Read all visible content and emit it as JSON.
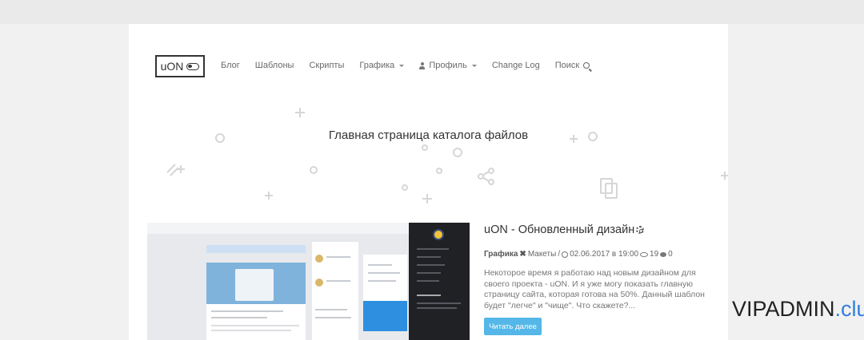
{
  "logo": {
    "text": "uON"
  },
  "nav": {
    "items": [
      {
        "label": "Блог"
      },
      {
        "label": "Шаблоны"
      },
      {
        "label": "Скрипты"
      },
      {
        "label": "Графика"
      },
      {
        "label": "Профиль"
      },
      {
        "label": "Change Log"
      },
      {
        "label": "Поиск"
      }
    ]
  },
  "hero": {
    "title": "Главная страница каталога файлов"
  },
  "post": {
    "title": "uON - Обновленный дизайн",
    "category": "Графика",
    "subcategory": "Макеты",
    "separator": "/",
    "date": "02.06.2017 в 19:00",
    "views": "19",
    "comments": "0",
    "excerpt": "Некоторое время я работаю над новым дизайном для своего проекта - uON. И я уже могу показать главную страницу сайта, которая готова на 50%. Данный шаблон будет \"легче\" и \"чище\". Что скажете?...",
    "read_more": "Читать далее"
  },
  "watermark": {
    "name": "VIPADMIN",
    "tld": ".club"
  },
  "colors": {
    "accent": "#54b7e8",
    "watermark_tld": "#2f7fe0"
  }
}
